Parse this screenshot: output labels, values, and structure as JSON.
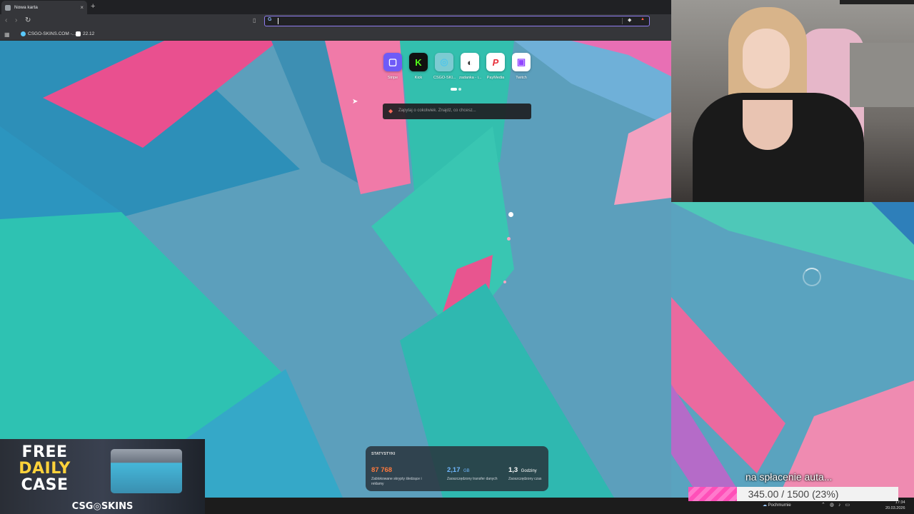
{
  "browser": {
    "tab_title": "Nowa karta",
    "new_tab_symbol": "+",
    "address_value": "",
    "bookmarks": [
      {
        "label": "CSGO-SKINS.COM -..."
      },
      {
        "label": "22.12"
      }
    ]
  },
  "speed_dial": [
    {
      "label": "Stripe",
      "icon": "stripe-icon",
      "color": "#6e5bf7"
    },
    {
      "label": "Kick",
      "icon": "kick-icon",
      "color": "#53fc18"
    },
    {
      "label": "CSGO-SKI...",
      "icon": "csgo-skins-icon",
      "color": "#9ed8e6"
    },
    {
      "label": "zadanka - i...",
      "icon": "zadanka-icon",
      "color": "#ffffff"
    },
    {
      "label": "PayMedia",
      "icon": "paymedia-icon",
      "color": "#e8303a"
    },
    {
      "label": "Twitch",
      "icon": "twitch-icon",
      "color": "#9146ff"
    }
  ],
  "leo": {
    "placeholder": "Zapytaj o cokolwiek. Znajdź, co chcesz..."
  },
  "stats": {
    "title": "STATYSTYKI",
    "items": [
      {
        "value": "87 768",
        "unit": "",
        "desc": "Zablokowane skrypty śledzące i reklamy",
        "color": "#ff7a3d"
      },
      {
        "value": "2,17",
        "unit": "GB",
        "desc": "Zaoszczędzony transfer danych",
        "color": "#6fb8ff"
      },
      {
        "value": "1,3",
        "unit": "Godziny",
        "desc": "Zaoszczędzony czas",
        "color": "#ffffff"
      }
    ]
  },
  "ad": {
    "line1": "FREE",
    "line2": "DAILY",
    "line3": "CASE",
    "brand": "CSG◎SKINS"
  },
  "goal": {
    "text": "na spłacenie auta...",
    "value": "345.00 / 1500 (23%)",
    "progress": 0.23
  },
  "taskbar": {
    "weather": "Pochmurnie",
    "time": "17:34",
    "date": "20.03.2026"
  }
}
